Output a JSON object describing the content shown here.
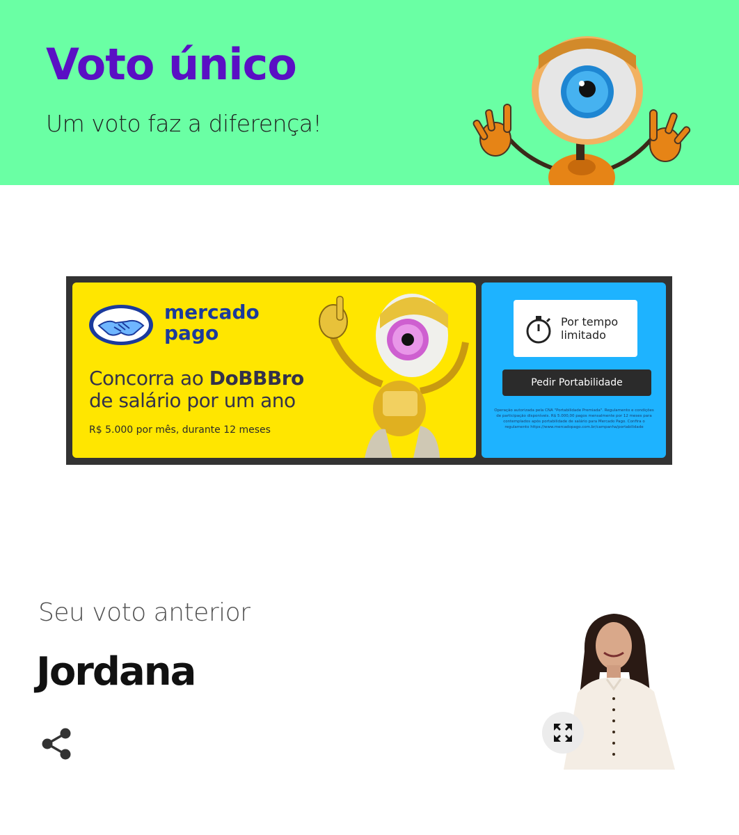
{
  "colors": {
    "header_bg": "#6affa4",
    "title": "#5a0fc4",
    "ad_yellow": "#ffe600",
    "ad_blue": "#1eb3ff",
    "mercado_blue": "#1b3a9c"
  },
  "header": {
    "title": "Voto único",
    "subtitle": "Um voto faz a diferença!",
    "mascot_icon": "big-brother-eye-robot-mascot"
  },
  "ad": {
    "brand_line1": "mercado",
    "brand_line2": "pago",
    "headline_pre": "Concorra ao ",
    "headline_bold": "DoBBBro",
    "headline_post": "de salário por um ano",
    "fineline": "R$ 5.000 por mês, durante 12 meses",
    "timer_line1": "Por tempo",
    "timer_line2": "limitado",
    "button_label": "Pedir Portabilidade",
    "legal_text": "Operação autorizada pela CNA \"Portabilidade Premiada\". Regulamento e condições de participação disponíveis. R$ 5.000,00 pagos mensalmente por 12 meses para contemplados após portabilidade de salário para Mercado Pago. Confira o regulamento https://www.mercadopago.com.br/campanha/portabilidade",
    "icons": [
      "handshake-icon",
      "stopwatch-icon",
      "robot-mascot"
    ]
  },
  "previous_vote": {
    "label": "Seu voto anterior",
    "name": "Jordana",
    "share_icon": "share-icon",
    "expand_icon": "expand-icon"
  }
}
